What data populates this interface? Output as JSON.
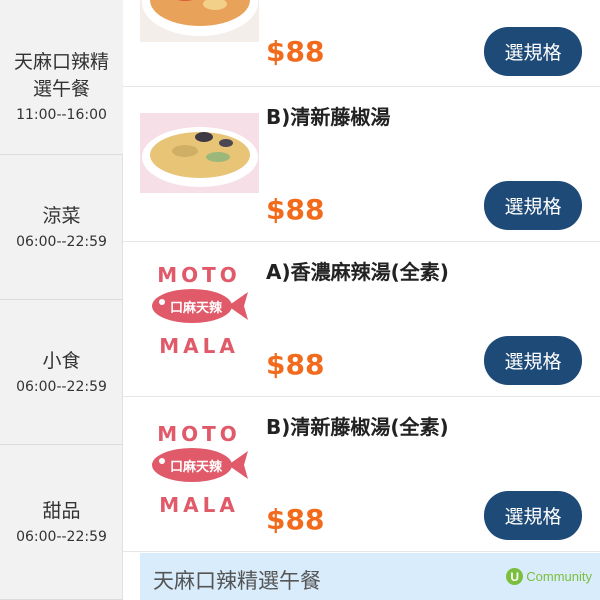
{
  "sidebar": {
    "categories": [
      {
        "title_line1": "天麻口辣精",
        "title_line2": "選午餐",
        "time": "11:00--16:00"
      },
      {
        "title": "涼菜",
        "time": "06:00--22:59"
      },
      {
        "title": "小食",
        "time": "06:00--22:59"
      },
      {
        "title": "甜品",
        "time": "06:00--22:59"
      }
    ]
  },
  "menu": {
    "items": [
      {
        "name": "",
        "price": "$88",
        "button": "選規格"
      },
      {
        "name": "B)清新藤椒湯",
        "price": "$88",
        "button": "選規格"
      },
      {
        "name": "A)香濃麻辣湯(全素)",
        "price": "$88",
        "button": "選規格"
      },
      {
        "name": "B)清新藤椒湯(全素)",
        "price": "$88",
        "button": "選規格"
      }
    ],
    "logo_text_top": "MOTO",
    "logo_text_bottom": "MALA",
    "logo_chars": "口麻天辣"
  },
  "section": {
    "title": "天麻口辣精選午餐"
  },
  "watermark": {
    "letter": "U",
    "text": "Community"
  },
  "colors": {
    "price": "#f26a1b",
    "button": "#1e4a78",
    "section_bar": "#d9ecfb",
    "logo": "#e05a6a"
  }
}
